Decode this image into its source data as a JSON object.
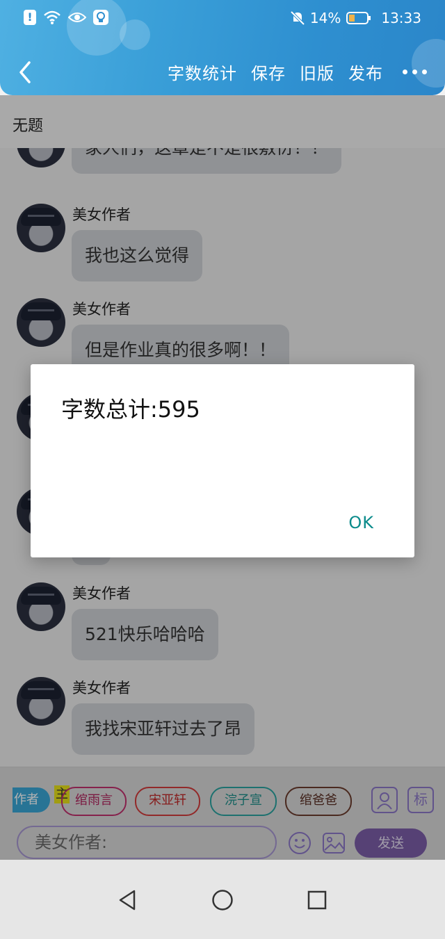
{
  "status_bar": {
    "time": "13:33",
    "battery": "14%",
    "left_icons": [
      "alert-icon",
      "wifi-icon",
      "eye-icon",
      "bulb-icon"
    ],
    "right_icons": [
      "mute-icon",
      "battery-icon"
    ]
  },
  "toolbar": {
    "actions": [
      "字数统计",
      "保存",
      "旧版",
      "发布"
    ],
    "back_icon": "back-arrow-icon",
    "more_icon": "more-icon"
  },
  "chapter_title": "无题",
  "messages": [
    {
      "sender": "",
      "text": "家人们，这章是不是很敷衍！！"
    },
    {
      "sender": "美女作者",
      "text": "我也这么觉得"
    },
    {
      "sender": "美女作者",
      "text": "但是作业真的很多啊！！"
    },
    {
      "sender": "美女作者",
      "text": "521快乐哈哈哈"
    },
    {
      "sender": "美女作者",
      "text": "我找宋亚轩过去了昂"
    }
  ],
  "dialog": {
    "message": "字数总计:595",
    "ok_label": "OK"
  },
  "input_bar": {
    "role_label": "作者",
    "main_tag": "主",
    "characters": [
      "绾雨言",
      "宋亚轩",
      "浣子宣",
      "绾爸爸"
    ],
    "placeholder": "美女作者:",
    "send_label": "发送",
    "side_icons": [
      "person-icon",
      "标"
    ]
  },
  "system_nav": [
    "back-triangle-icon",
    "home-circle-icon",
    "recents-square-icon"
  ],
  "colors": {
    "header": "#3a9fd8",
    "accent_teal": "#0b8b8b",
    "send": "#7b5ea8",
    "role_badge": "#3aa6d6"
  }
}
